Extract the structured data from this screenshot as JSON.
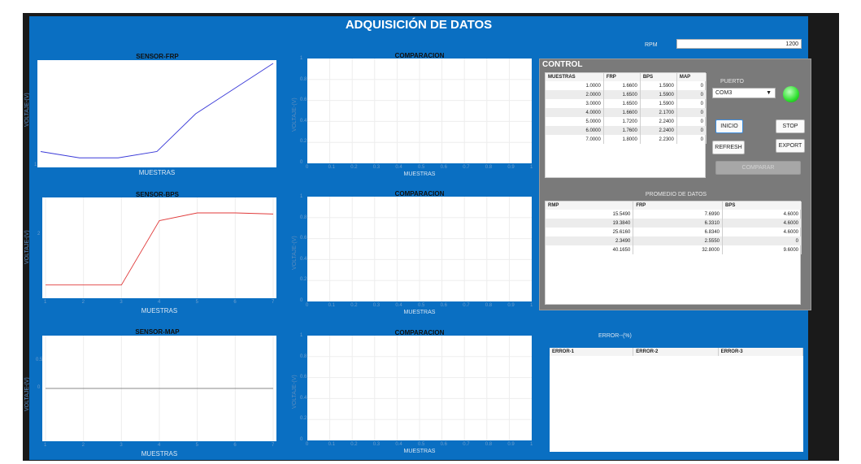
{
  "title": "ADQUISICIÓN DE DATOS",
  "rpm": {
    "label": "RPM",
    "value": "1200"
  },
  "left_plots": [
    {
      "title": "SENSOR-FRP",
      "xlabel": "MUESTRAS",
      "ylabel": "VOLTAJE-(V)",
      "ytick": "1",
      "xticks": []
    },
    {
      "title": "SENSOR-BPS",
      "xlabel": "MUESTRAS",
      "ylabel": "VOLTAJE-(V)",
      "ytick": "2",
      "xticks": [
        "1",
        "2",
        "3",
        "4",
        "5",
        "6",
        "7"
      ]
    },
    {
      "title": "SENSOR-MAP",
      "xlabel": "MUESTRAS",
      "ylabel": "VOLTAJE-(V)",
      "yticks": [
        "1",
        "0.5",
        "0"
      ],
      "xticks": [
        "1",
        "2",
        "3",
        "4",
        "5",
        "6",
        "7"
      ]
    }
  ],
  "compare_plots": {
    "title": "COMPARACION",
    "xlabel": "MUESTRAS",
    "ylabel": "VOLTAJE-(V)",
    "yticks": [
      "1",
      "0.8",
      "0.6",
      "0.4",
      "0.2",
      "0"
    ],
    "xticks": [
      "0",
      "0.1",
      "0.2",
      "0.3",
      "0.4",
      "0.5",
      "0.6",
      "0.7",
      "0.8",
      "0.9",
      "1"
    ]
  },
  "control": {
    "title": "CONTROL",
    "table": {
      "headers": [
        "MUESTRAS",
        "FRP",
        "BPS",
        "MAP"
      ],
      "rows": [
        [
          "1.0000",
          "1.6600",
          "1.5900",
          "0"
        ],
        [
          "2.0000",
          "1.6500",
          "1.5900",
          "0"
        ],
        [
          "3.0000",
          "1.6500",
          "1.5900",
          "0"
        ],
        [
          "4.0000",
          "1.6600",
          "2.1700",
          "0"
        ],
        [
          "5.0000",
          "1.7200",
          "2.2400",
          "0"
        ],
        [
          "6.0000",
          "1.7600",
          "2.2400",
          "0"
        ],
        [
          "7.0000",
          "1.8000",
          "2.2300",
          "0"
        ]
      ]
    },
    "port_label": "PUERTO",
    "port_value": "COM3",
    "buttons": {
      "start": "INICIO",
      "stop": "STOP",
      "refresh": "REFRESH",
      "export": "EXPORT",
      "compare": "COMPARAR"
    },
    "status_color": "#2ee02e",
    "avg_title": "PROMEDIO DE DATOS",
    "avg_table": {
      "headers": [
        "RMP",
        "FRP",
        "BPS"
      ],
      "rows": [
        [
          "15.5490",
          "7.6990",
          "4.6000"
        ],
        [
          "19.3840",
          "6.3310",
          "4.6000"
        ],
        [
          "25.6160",
          "6.8340",
          "4.6000"
        ],
        [
          "2.3490",
          "2.5550",
          "0"
        ],
        [
          "40.1650",
          "32.8000",
          "9.6000"
        ]
      ]
    }
  },
  "error": {
    "title": "ERROR--(%)",
    "headers": [
      "ERROR-1",
      "ERROR-2",
      "ERROR-3"
    ]
  },
  "chart_data": [
    {
      "type": "line",
      "title": "SENSOR-FRP",
      "xlabel": "MUESTRAS",
      "x": [
        1,
        2,
        3,
        4,
        5,
        6,
        7
      ],
      "series": [
        {
          "color": "#3a3ad8",
          "values": [
            1.66,
            1.65,
            1.65,
            1.66,
            1.72,
            1.76,
            1.8
          ]
        }
      ]
    },
    {
      "type": "line",
      "title": "SENSOR-BPS",
      "xlabel": "MUESTRAS",
      "x": [
        1,
        2,
        3,
        4,
        5,
        6,
        7
      ],
      "series": [
        {
          "color": "#e03a3a",
          "values": [
            1.59,
            1.59,
            1.59,
            2.17,
            2.24,
            2.24,
            2.23
          ]
        }
      ]
    },
    {
      "type": "line",
      "title": "SENSOR-MAP",
      "xlabel": "MUESTRAS",
      "x": [
        1,
        2,
        3,
        4,
        5,
        6,
        7
      ],
      "series": [
        {
          "color": "#888888",
          "values": [
            0,
            0,
            0,
            0,
            0,
            0,
            0
          ]
        }
      ]
    }
  ]
}
